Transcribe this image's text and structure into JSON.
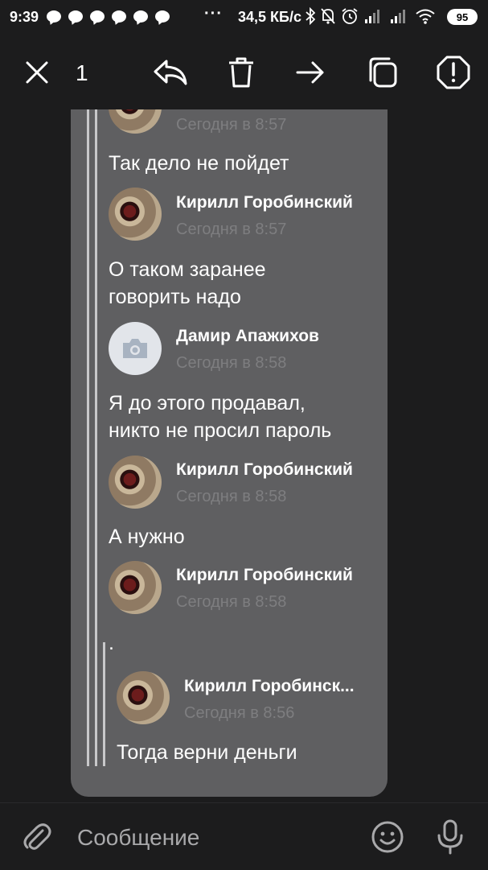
{
  "status_bar": {
    "time": "9:39",
    "network_speed": "34,5 КБ/с",
    "battery": "95",
    "more": "···"
  },
  "toolbar": {
    "selected_count": "1",
    "icons": [
      "close-icon",
      "reply-icon",
      "delete-icon",
      "forward-icon",
      "copy-icon",
      "report-icon"
    ]
  },
  "messages": [
    {
      "time": "Сегодня в 8:57"
    },
    {
      "text": "Так дело не пойдет"
    },
    {
      "author": "Кирилл Горобинский",
      "time": "Сегодня в 8:57",
      "text_lines": [
        "О таком заранее",
        "говорить надо"
      ]
    },
    {
      "author": "Дамир Апажихов",
      "time": "Сегодня в 8:58",
      "text_lines": [
        "Я до этого продавал,",
        "никто не просил пароль"
      ]
    },
    {
      "author": "Кирилл Горобинский",
      "time": "Сегодня в 8:58",
      "text": "А нужно"
    },
    {
      "author": "Кирилл Горобинский",
      "time": "Сегодня в 8:58",
      "text": "."
    },
    {
      "author": "Кирилл Горобинск...",
      "time": "Сегодня в 8:56",
      "text": "Тогда верни деньги"
    }
  ],
  "input": {
    "placeholder": "Сообщение"
  },
  "colors": {
    "background": "#1c1c1d",
    "card": "#5f5f61",
    "timestamp": "#7e7e80",
    "quote_line": "#c8c8ca"
  }
}
